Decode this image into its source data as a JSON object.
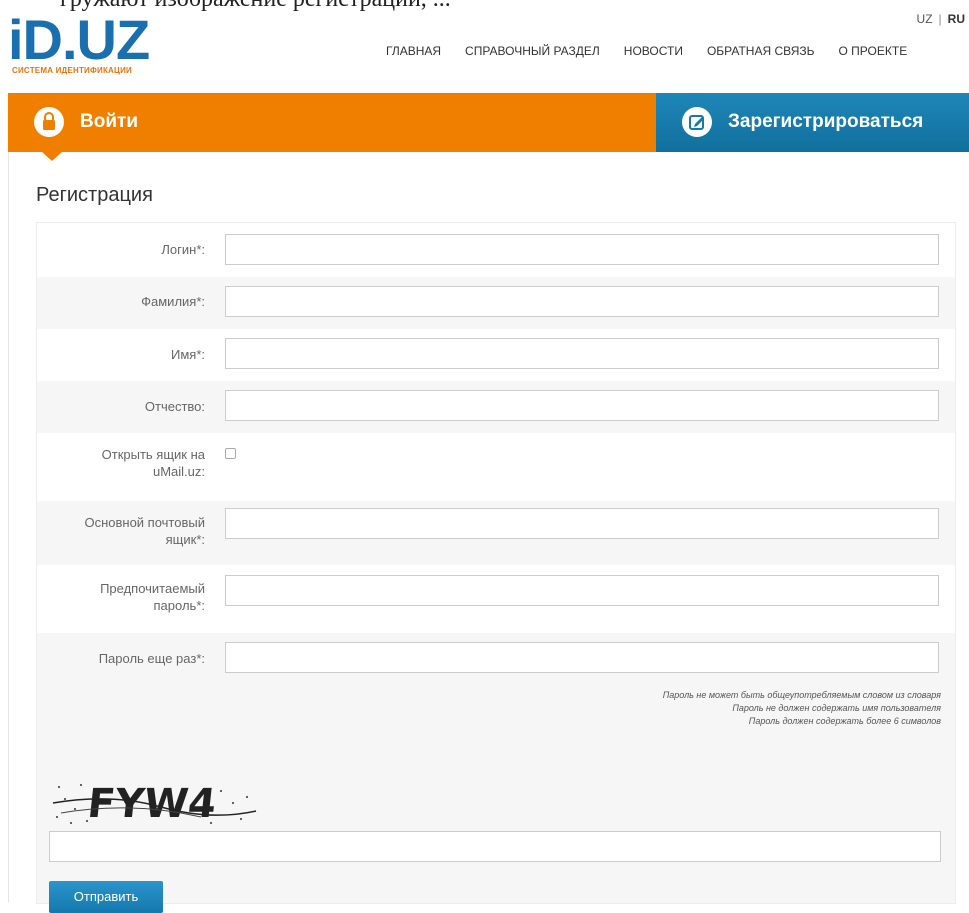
{
  "header": {
    "top_cut_text": "гружают изображение регистрации, ...",
    "logo_text": "iD.UZ",
    "logo_subtitle": "СИСТЕМА ИДЕНТИФИКАЦИИ",
    "lang_uz": "UZ",
    "lang_sep": "|",
    "lang_ru": "RU",
    "nav": [
      "ГЛАВНАЯ",
      "СПРАВОЧНЫЙ РАЗДЕЛ",
      "НОВОСТИ",
      "ОБРАТНАЯ СВЯЗЬ",
      "О ПРОЕКТЕ"
    ]
  },
  "tabs": {
    "login": "Войти",
    "register": "Зарегистрироваться"
  },
  "form": {
    "title": "Регистрация",
    "fields": {
      "login": "Логин*:",
      "surname": "Фамилия*:",
      "name": "Имя*:",
      "patronymic": "Отчество:",
      "umail_line1": "Открыть ящик на",
      "umail_line2": "uMail.uz:",
      "email_line1": "Основной почтовый",
      "email_line2": "ящик*:",
      "password_line1": "Предпочитаемый",
      "password_line2": "пароль*:",
      "password_repeat": "Пароль еще раз*:"
    },
    "hints": [
      "Пароль не может быть общеупотребляемым словом из словаря",
      "Пароль не должен содержать имя пользователя",
      "Пароль должен содержать более 6 символов"
    ],
    "captcha_text": "FYW4",
    "submit_label": "Отправить"
  },
  "colors": {
    "orange": "#f07f00",
    "blue": "#147aab",
    "logo_blue": "#1a6fae"
  }
}
